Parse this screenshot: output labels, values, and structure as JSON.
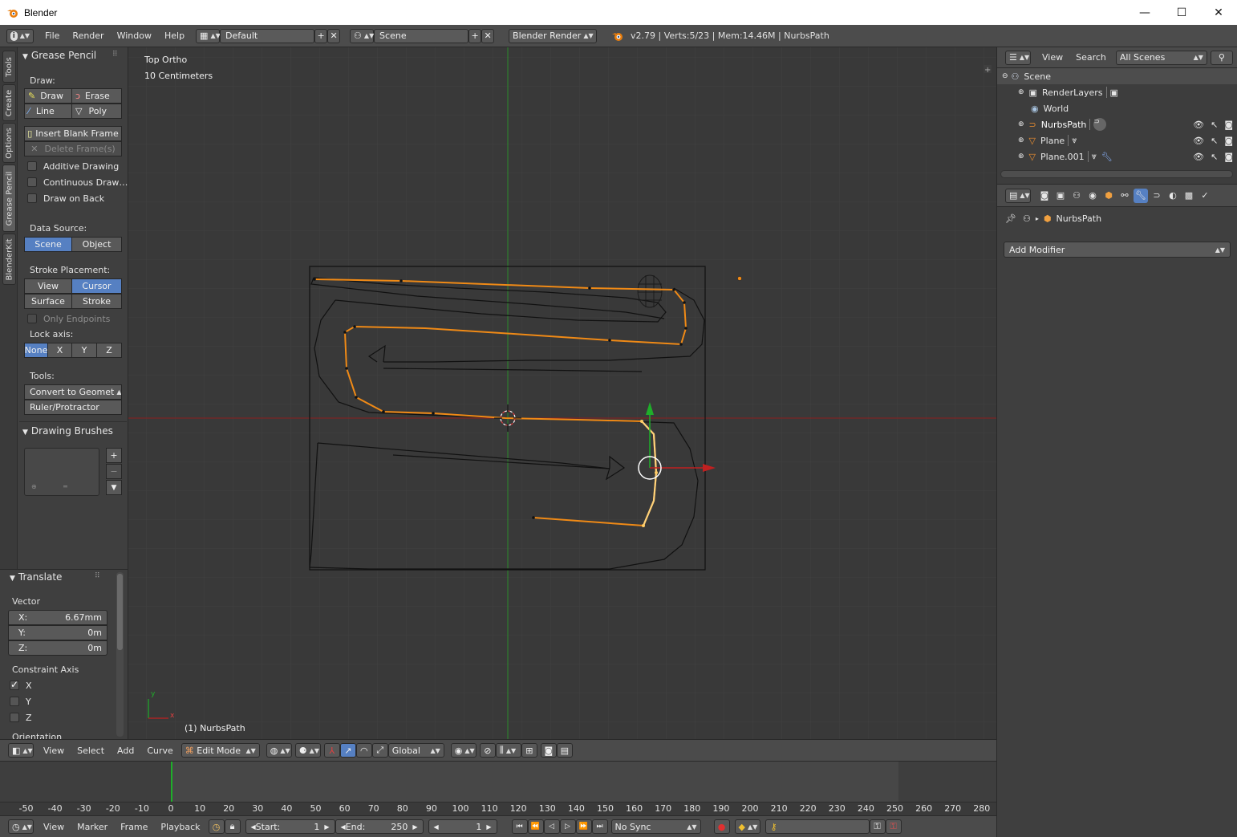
{
  "window": {
    "title": "Blender",
    "min_glyph": "—",
    "max_glyph": "☐",
    "close_glyph": "✕"
  },
  "info_header": {
    "menus": [
      "File",
      "Render",
      "Window",
      "Help"
    ],
    "screen_layout": "Default",
    "scene": "Scene",
    "render_engine": "Blender Render",
    "stats": "v2.79 | Verts:5/23 | Mem:14.46M | NurbsPath"
  },
  "left_tabs": [
    "Tools",
    "Create",
    "Options",
    "Grease Pencil",
    "BlenderKit"
  ],
  "grease_pencil_panel": {
    "title": "Grease Pencil",
    "draw_label": "Draw:",
    "draw_btn": "Draw",
    "erase_btn": "Erase",
    "line_btn": "Line",
    "poly_btn": "Poly",
    "insert_blank_frame": "Insert Blank Frame",
    "delete_frames": "Delete Frame(s)",
    "additive_drawing": "Additive Drawing",
    "continuous_drawing": "Continuous Draw…",
    "draw_on_back": "Draw on Back",
    "data_source_label": "Data Source:",
    "data_source_scene": "Scene",
    "data_source_object": "Object",
    "stroke_placement_label": "Stroke Placement:",
    "sp_view": "View",
    "sp_cursor": "Cursor",
    "sp_surface": "Surface",
    "sp_stroke": "Stroke",
    "only_endpoints": "Only Endpoints",
    "lock_axis_label": "Lock axis:",
    "lock_none": "None",
    "lock_x": "X",
    "lock_y": "Y",
    "lock_z": "Z",
    "tools_label": "Tools:",
    "convert_to_geometry": "Convert to Geomet",
    "ruler_protractor": "Ruler/Protractor"
  },
  "drawing_brushes": {
    "title": "Drawing Brushes"
  },
  "translate_panel": {
    "title": "Translate",
    "vector_label": "Vector",
    "x_label": "X:",
    "x_value": "6.67mm",
    "y_label": "Y:",
    "y_value": "0m",
    "z_label": "Z:",
    "z_value": "0m",
    "constraint_axis_label": "Constraint Axis",
    "axis_x": "X",
    "axis_y": "Y",
    "axis_z": "Z",
    "orientation_label": "Orientation"
  },
  "viewport": {
    "view_name": "Top Ortho",
    "scale": "10 Centimeters",
    "active_object": "(1) NurbsPath",
    "axis_x": "x",
    "axis_y": "y"
  },
  "viewport_header": {
    "menus": [
      "View",
      "Select",
      "Add",
      "Curve"
    ],
    "mode": "Edit Mode",
    "orientation": "Global"
  },
  "timeline": {
    "ticks": [
      "-50",
      "-40",
      "-30",
      "-20",
      "-10",
      "0",
      "10",
      "20",
      "30",
      "40",
      "50",
      "60",
      "70",
      "80",
      "90",
      "100",
      "110",
      "120",
      "130",
      "140",
      "150",
      "160",
      "170",
      "180",
      "190",
      "200",
      "210",
      "220",
      "230",
      "240",
      "250",
      "260",
      "270",
      "280"
    ],
    "current_frame": 1,
    "menus": [
      "View",
      "Marker",
      "Frame",
      "Playback"
    ],
    "start_label": "Start:",
    "start_value": "1",
    "end_label": "End:",
    "end_value": "250",
    "frame_value": "1",
    "sync": "No Sync"
  },
  "outliner": {
    "menus": [
      "View",
      "Search"
    ],
    "filter": "All Scenes",
    "items": [
      {
        "name": "Scene",
        "indent": 0
      },
      {
        "name": "RenderLayers",
        "indent": 1
      },
      {
        "name": "World",
        "indent": 1
      },
      {
        "name": "NurbsPath",
        "indent": 1
      },
      {
        "name": "Plane",
        "indent": 1
      },
      {
        "name": "Plane.001",
        "indent": 1
      }
    ]
  },
  "properties": {
    "context_object": "NurbsPath",
    "add_modifier": "Add Modifier"
  },
  "colors": {
    "accent": "#5680c2",
    "curve": "#f08a16",
    "x_axis": "#c02020",
    "y_axis": "#1fae2a"
  }
}
